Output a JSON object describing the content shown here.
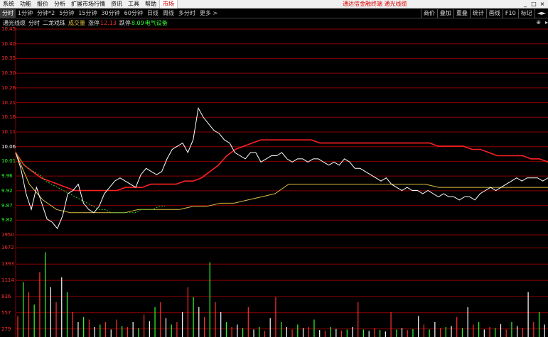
{
  "menu": {
    "items": [
      "系统",
      "功能",
      "报价",
      "分析",
      "扩展市场行情",
      "资讯",
      "工具",
      "帮助"
    ],
    "market": "市场",
    "brand": "通达信金融终端  通光线缆",
    "window_controls": [
      "_",
      "□",
      "×"
    ]
  },
  "toolbar": {
    "periods": [
      "分时",
      "1分钟",
      "分钟*2",
      "5分钟",
      "15分钟",
      "30分钟",
      "60分钟",
      "日线",
      "周线",
      "多分时",
      "更多 >"
    ],
    "active": "分时",
    "right": [
      "商价",
      "叠加",
      "重叠",
      "统计",
      "画线",
      "F10",
      "标记",
      "◄►"
    ]
  },
  "info": {
    "stock": "通光线缆",
    "mode": "分时",
    "indicator": "二龙戏珠",
    "vol_label": "成交量",
    "limit_up_label": "涨停",
    "limit_up": "12.13",
    "limit_down_label": "跌停",
    "limit_down": "8.09",
    "sector": "电气设备",
    "icons": [
      "⊕",
      "▸"
    ]
  },
  "colors": {
    "up": "#ff3030",
    "down": "#30ff30",
    "grid": "#8b0000",
    "price_line": "#ffffff",
    "ma_red": "#ff2020",
    "ma_yellow": "#e0c040",
    "ma_green": "#30d030"
  },
  "chart_data": {
    "type": "line",
    "price_axis": {
      "labels": [
        "10.45",
        "10.40",
        "10.35",
        "10.30",
        "10.26",
        "10.21",
        "10.16",
        "10.11",
        "10.06",
        "10.01",
        "9.96",
        "9.92",
        "9.87",
        "9.82",
        "1950"
      ],
      "reference": "10.06",
      "ylim": [
        9.8,
        10.45
      ]
    },
    "volume_axis": {
      "labels": [
        "1672",
        "1393",
        "1114",
        "836",
        "557",
        "279"
      ],
      "ylim": [
        0,
        1950
      ]
    },
    "series": [
      {
        "key": "price",
        "color": "#ffffff",
        "values": [
          10.06,
          10.01,
          9.93,
          9.88,
          9.95,
          9.9,
          9.85,
          9.84,
          9.82,
          9.86,
          9.93,
          9.94,
          9.96,
          9.9,
          9.88,
          9.87,
          9.89,
          9.93,
          9.95,
          9.97,
          9.98,
          9.97,
          9.96,
          9.95,
          9.99,
          10.01,
          10.0,
          9.99,
          10.0,
          10.04,
          10.07,
          10.08,
          10.09,
          10.06,
          10.1,
          10.2,
          10.17,
          10.15,
          10.13,
          10.12,
          10.1,
          10.09,
          10.06,
          10.05,
          10.04,
          10.06,
          10.06,
          10.03,
          10.04,
          10.05,
          10.05,
          10.06,
          10.04,
          10.03,
          10.04,
          10.04,
          10.03,
          10.04,
          10.04,
          10.03,
          10.02,
          10.03,
          10.02,
          10.04,
          10.03,
          10.01,
          10.01,
          10.0,
          9.99,
          9.98,
          9.97,
          9.98,
          9.96,
          9.95,
          9.94,
          9.95,
          9.94,
          9.94,
          9.93,
          9.94,
          9.93,
          9.92,
          9.93,
          9.92,
          9.92,
          9.91,
          9.92,
          9.92,
          9.91,
          9.93,
          9.94,
          9.95,
          9.94,
          9.95,
          9.96,
          9.97,
          9.98,
          9.97,
          9.98,
          9.98,
          9.98,
          9.97,
          9.98
        ]
      },
      {
        "key": "ma_red",
        "color": "#ff2020",
        "values": [
          10.06,
          10.02,
          10.0,
          9.98,
          9.97,
          9.96,
          9.95,
          9.94,
          9.94,
          9.94,
          9.94,
          9.94,
          9.94,
          9.95,
          9.95,
          9.95,
          9.96,
          9.96,
          9.96,
          9.96,
          9.97,
          9.97,
          9.98,
          10.0,
          10.02,
          10.05,
          10.07,
          10.08,
          10.09,
          10.1,
          10.1,
          10.1,
          10.1,
          10.1,
          10.1,
          10.1,
          10.09,
          10.09,
          10.09,
          10.09,
          10.09,
          10.09,
          10.09,
          10.09,
          10.09,
          10.09,
          10.09,
          10.09,
          10.09,
          10.09,
          10.08,
          10.08,
          10.08,
          10.08,
          10.07,
          10.07,
          10.06,
          10.05,
          10.05,
          10.05,
          10.05,
          10.04,
          10.04,
          10.03
        ]
      },
      {
        "key": "ma_yellow",
        "color": "#e0c040",
        "values": [
          10.06,
          9.96,
          9.91,
          9.88,
          9.87,
          9.87,
          9.87,
          9.87,
          9.87,
          9.88,
          9.88,
          9.88,
          9.88,
          9.89,
          9.89,
          9.9,
          9.9,
          9.91,
          9.92,
          9.93,
          9.96,
          9.96,
          9.96,
          9.96,
          9.96,
          9.96,
          9.96,
          9.96,
          9.96,
          9.96,
          9.96,
          9.95,
          9.95,
          9.95,
          9.95,
          9.95,
          9.95,
          9.95,
          9.95,
          9.95
        ]
      },
      {
        "key": "ma_green",
        "color": "#30d030",
        "values": [
          10.06,
          10.03,
          10.01,
          10.0,
          9.99,
          9.97,
          9.96,
          9.95,
          9.94,
          9.93,
          9.92,
          9.91,
          9.9,
          9.89,
          9.88,
          9.88,
          9.87,
          9.87,
          9.87,
          9.87,
          9.87,
          9.88,
          9.88,
          9.88,
          9.89,
          9.89
        ]
      }
    ],
    "volume": [
      {
        "v": 420,
        "c": "r"
      },
      {
        "v": 1100,
        "c": "g"
      },
      {
        "v": 900,
        "c": "r"
      },
      {
        "v": 650,
        "c": "g"
      },
      {
        "v": 1300,
        "c": "r"
      },
      {
        "v": 1700,
        "c": "g"
      },
      {
        "v": 1000,
        "c": "w"
      },
      {
        "v": 700,
        "c": "r"
      },
      {
        "v": 1200,
        "c": "w"
      },
      {
        "v": 900,
        "c": "g"
      },
      {
        "v": 500,
        "c": "r"
      },
      {
        "v": 300,
        "c": "w"
      },
      {
        "v": 400,
        "c": "g"
      },
      {
        "v": 350,
        "c": "r"
      },
      {
        "v": 200,
        "c": "w"
      },
      {
        "v": 250,
        "c": "g"
      },
      {
        "v": 300,
        "c": "r"
      },
      {
        "v": 150,
        "c": "w"
      },
      {
        "v": 350,
        "c": "r"
      },
      {
        "v": 220,
        "c": "g"
      },
      {
        "v": 200,
        "c": "r"
      },
      {
        "v": 300,
        "c": "w"
      },
      {
        "v": 180,
        "c": "g"
      },
      {
        "v": 450,
        "c": "r"
      },
      {
        "v": 320,
        "c": "w"
      },
      {
        "v": 600,
        "c": "g"
      },
      {
        "v": 700,
        "c": "r"
      },
      {
        "v": 380,
        "c": "w"
      },
      {
        "v": 250,
        "c": "g"
      },
      {
        "v": 300,
        "c": "r"
      },
      {
        "v": 500,
        "c": "w"
      },
      {
        "v": 1000,
        "c": "r"
      },
      {
        "v": 800,
        "c": "g"
      },
      {
        "v": 600,
        "c": "w"
      },
      {
        "v": 400,
        "c": "r"
      },
      {
        "v": 1500,
        "c": "g"
      },
      {
        "v": 700,
        "c": "r"
      },
      {
        "v": 500,
        "c": "w"
      },
      {
        "v": 300,
        "c": "g"
      },
      {
        "v": 200,
        "c": "r"
      },
      {
        "v": 250,
        "c": "w"
      },
      {
        "v": 180,
        "c": "g"
      },
      {
        "v": 600,
        "c": "r"
      },
      {
        "v": 150,
        "c": "w"
      },
      {
        "v": 200,
        "c": "g"
      },
      {
        "v": 120,
        "c": "r"
      },
      {
        "v": 380,
        "c": "w"
      },
      {
        "v": 800,
        "c": "r"
      },
      {
        "v": 300,
        "c": "g"
      },
      {
        "v": 200,
        "c": "w"
      },
      {
        "v": 150,
        "c": "r"
      },
      {
        "v": 250,
        "c": "g"
      },
      {
        "v": 180,
        "c": "w"
      },
      {
        "v": 200,
        "c": "r"
      },
      {
        "v": 350,
        "c": "g"
      },
      {
        "v": 140,
        "c": "w"
      },
      {
        "v": 120,
        "c": "r"
      },
      {
        "v": 200,
        "c": "g"
      },
      {
        "v": 160,
        "c": "w"
      },
      {
        "v": 130,
        "c": "r"
      },
      {
        "v": 150,
        "c": "g"
      },
      {
        "v": 200,
        "c": "w"
      },
      {
        "v": 700,
        "c": "r"
      },
      {
        "v": 150,
        "c": "g"
      },
      {
        "v": 120,
        "c": "w"
      },
      {
        "v": 180,
        "c": "r"
      },
      {
        "v": 140,
        "c": "g"
      },
      {
        "v": 110,
        "c": "w"
      },
      {
        "v": 500,
        "c": "r"
      },
      {
        "v": 150,
        "c": "g"
      },
      {
        "v": 180,
        "c": "w"
      },
      {
        "v": 140,
        "c": "r"
      },
      {
        "v": 160,
        "c": "g"
      },
      {
        "v": 420,
        "c": "w"
      },
      {
        "v": 250,
        "c": "r"
      },
      {
        "v": 150,
        "c": "g"
      },
      {
        "v": 300,
        "c": "w"
      },
      {
        "v": 180,
        "c": "r"
      },
      {
        "v": 200,
        "c": "g"
      },
      {
        "v": 220,
        "c": "w"
      },
      {
        "v": 400,
        "c": "r"
      },
      {
        "v": 180,
        "c": "g"
      },
      {
        "v": 600,
        "c": "w"
      },
      {
        "v": 250,
        "c": "r"
      },
      {
        "v": 300,
        "c": "g"
      },
      {
        "v": 150,
        "c": "w"
      },
      {
        "v": 200,
        "c": "r"
      },
      {
        "v": 180,
        "c": "g"
      },
      {
        "v": 260,
        "c": "w"
      },
      {
        "v": 150,
        "c": "r"
      },
      {
        "v": 300,
        "c": "g"
      },
      {
        "v": 220,
        "c": "w"
      },
      {
        "v": 180,
        "c": "r"
      },
      {
        "v": 900,
        "c": "w"
      },
      {
        "v": 300,
        "c": "r"
      },
      {
        "v": 500,
        "c": "g"
      },
      {
        "v": 250,
        "c": "w"
      }
    ]
  }
}
